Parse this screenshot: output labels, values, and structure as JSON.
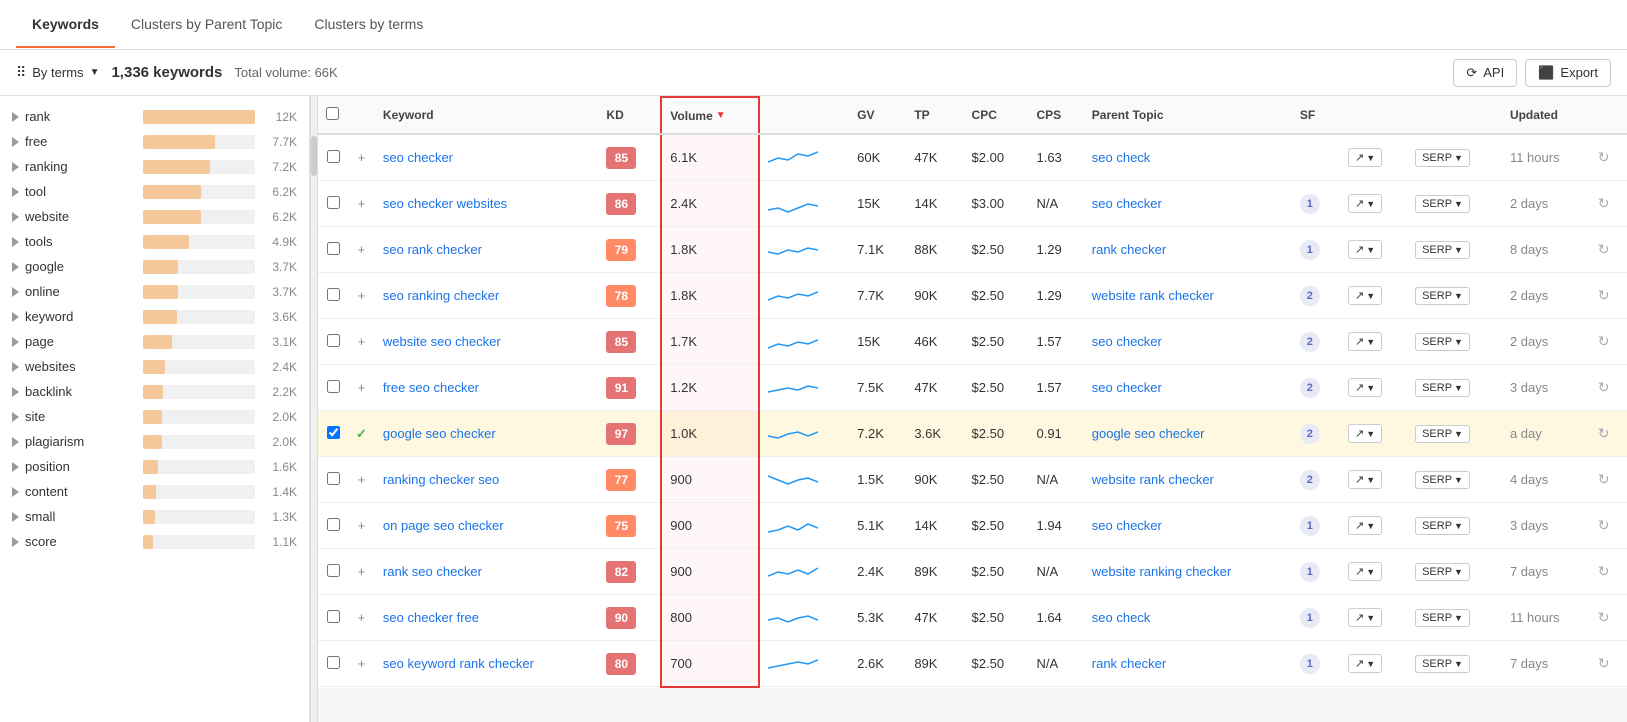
{
  "nav": {
    "tabs": [
      {
        "label": "Keywords",
        "active": true
      },
      {
        "label": "Clusters by Parent Topic",
        "active": false
      },
      {
        "label": "Clusters by terms",
        "active": false
      }
    ]
  },
  "toolbar": {
    "by_terms_label": "By terms",
    "keywords_count": "1,336 keywords",
    "total_volume": "Total volume: 66K",
    "api_label": "API",
    "export_label": "Export"
  },
  "sidebar": {
    "items": [
      {
        "label": "rank",
        "count": "12K",
        "pct": 100
      },
      {
        "label": "free",
        "count": "7.7K",
        "pct": 64
      },
      {
        "label": "ranking",
        "count": "7.2K",
        "pct": 60
      },
      {
        "label": "tool",
        "count": "6.2K",
        "pct": 52
      },
      {
        "label": "website",
        "count": "6.2K",
        "pct": 52
      },
      {
        "label": "tools",
        "count": "4.9K",
        "pct": 41
      },
      {
        "label": "google",
        "count": "3.7K",
        "pct": 31
      },
      {
        "label": "online",
        "count": "3.7K",
        "pct": 31
      },
      {
        "label": "keyword",
        "count": "3.6K",
        "pct": 30
      },
      {
        "label": "page",
        "count": "3.1K",
        "pct": 26
      },
      {
        "label": "websites",
        "count": "2.4K",
        "pct": 20
      },
      {
        "label": "backlink",
        "count": "2.2K",
        "pct": 18
      },
      {
        "label": "site",
        "count": "2.0K",
        "pct": 17
      },
      {
        "label": "plagiarism",
        "count": "2.0K",
        "pct": 17
      },
      {
        "label": "position",
        "count": "1.6K",
        "pct": 13
      },
      {
        "label": "content",
        "count": "1.4K",
        "pct": 12
      },
      {
        "label": "small",
        "count": "1.3K",
        "pct": 11
      },
      {
        "label": "score",
        "count": "1.1K",
        "pct": 9
      }
    ]
  },
  "table": {
    "columns": [
      "",
      "",
      "Keyword",
      "KD",
      "Volume",
      "",
      "GV",
      "TP",
      "CPC",
      "CPS",
      "Parent Topic",
      "SF",
      "",
      "",
      "Updated"
    ],
    "rows": [
      {
        "checked": false,
        "expanded": true,
        "keyword": "seo checker",
        "kd": 85,
        "kd_color": "red",
        "volume": "6.1K",
        "gv": "60K",
        "tp": "47K",
        "cpc": "$2.00",
        "cps": "1.63",
        "parent_topic": "seo check",
        "sf": "",
        "updated": "11 hours"
      },
      {
        "checked": false,
        "expanded": true,
        "keyword": "seo checker websites",
        "kd": 86,
        "kd_color": "red",
        "volume": "2.4K",
        "gv": "15K",
        "tp": "14K",
        "cpc": "$3.00",
        "cps": "N/A",
        "parent_topic": "seo checker",
        "sf": "1",
        "updated": "2 days"
      },
      {
        "checked": false,
        "expanded": true,
        "keyword": "seo rank checker",
        "kd": 79,
        "kd_color": "orange",
        "volume": "1.8K",
        "gv": "7.1K",
        "tp": "88K",
        "cpc": "$2.50",
        "cps": "1.29",
        "parent_topic": "rank checker",
        "sf": "1",
        "updated": "8 days"
      },
      {
        "checked": false,
        "expanded": true,
        "keyword": "seo ranking checker",
        "kd": 78,
        "kd_color": "orange",
        "volume": "1.8K",
        "gv": "7.7K",
        "tp": "90K",
        "cpc": "$2.50",
        "cps": "1.29",
        "parent_topic": "website rank checker",
        "sf": "2",
        "updated": "2 days"
      },
      {
        "checked": false,
        "expanded": true,
        "keyword": "website seo checker",
        "kd": 85,
        "kd_color": "red",
        "volume": "1.7K",
        "gv": "15K",
        "tp": "46K",
        "cpc": "$2.50",
        "cps": "1.57",
        "parent_topic": "seo checker",
        "sf": "2",
        "updated": "2 days"
      },
      {
        "checked": false,
        "expanded": true,
        "keyword": "free seo checker",
        "kd": 91,
        "kd_color": "red",
        "volume": "1.2K",
        "gv": "7.5K",
        "tp": "47K",
        "cpc": "$2.50",
        "cps": "1.57",
        "parent_topic": "seo checker",
        "sf": "2",
        "updated": "3 days"
      },
      {
        "checked": true,
        "expanded": true,
        "keyword": "google seo checker",
        "kd": 97,
        "kd_color": "red",
        "volume": "1.0K",
        "gv": "7.2K",
        "tp": "3.6K",
        "cpc": "$2.50",
        "cps": "0.91",
        "parent_topic": "google seo checker",
        "sf": "2",
        "updated": "a day"
      },
      {
        "checked": false,
        "expanded": true,
        "keyword": "ranking checker seo",
        "kd": 77,
        "kd_color": "orange",
        "volume": "900",
        "gv": "1.5K",
        "tp": "90K",
        "cpc": "$2.50",
        "cps": "N/A",
        "parent_topic": "website rank checker",
        "sf": "2",
        "updated": "4 days"
      },
      {
        "checked": false,
        "expanded": true,
        "keyword": "on page seo checker",
        "kd": 75,
        "kd_color": "orange",
        "volume": "900",
        "gv": "5.1K",
        "tp": "14K",
        "cpc": "$2.50",
        "cps": "1.94",
        "parent_topic": "seo checker",
        "sf": "1",
        "updated": "3 days"
      },
      {
        "checked": false,
        "expanded": true,
        "keyword": "rank seo checker",
        "kd": 82,
        "kd_color": "red",
        "volume": "900",
        "gv": "2.4K",
        "tp": "89K",
        "cpc": "$2.50",
        "cps": "N/A",
        "parent_topic": "website ranking checker",
        "sf": "1",
        "updated": "7 days"
      },
      {
        "checked": false,
        "expanded": true,
        "keyword": "seo checker free",
        "kd": 90,
        "kd_color": "red",
        "volume": "800",
        "gv": "5.3K",
        "tp": "47K",
        "cpc": "$2.50",
        "cps": "1.64",
        "parent_topic": "seo check",
        "sf": "1",
        "updated": "11 hours"
      },
      {
        "checked": false,
        "expanded": true,
        "keyword": "seo keyword rank checker",
        "kd": 80,
        "kd_color": "red",
        "volume": "700",
        "gv": "2.6K",
        "tp": "89K",
        "cpc": "$2.50",
        "cps": "N/A",
        "parent_topic": "rank checker",
        "sf": "1",
        "updated": "7 days"
      }
    ]
  }
}
